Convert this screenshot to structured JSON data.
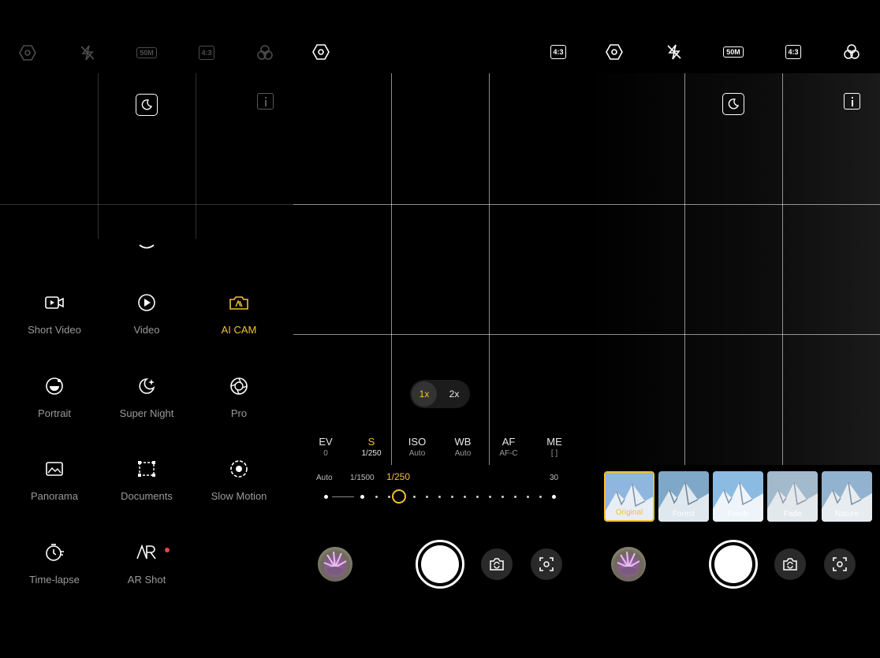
{
  "colors": {
    "accent": "#f2c230",
    "background": "#000000",
    "label": "#9a9a9a"
  },
  "mode_menu": {
    "modes": [
      {
        "label": "Short Video",
        "icon": "short-video-icon",
        "active": false
      },
      {
        "label": "Video",
        "icon": "video-icon",
        "active": false
      },
      {
        "label": "AI CAM",
        "icon": "ai-cam-icon",
        "active": true
      },
      {
        "label": "Portrait",
        "icon": "portrait-icon",
        "active": false
      },
      {
        "label": "Super Night",
        "icon": "super-night-icon",
        "active": false
      },
      {
        "label": "Pro",
        "icon": "pro-icon",
        "active": false
      },
      {
        "label": "Panorama",
        "icon": "panorama-icon",
        "active": false
      },
      {
        "label": "Documents",
        "icon": "documents-icon",
        "active": false
      },
      {
        "label": "Slow Motion",
        "icon": "slow-motion-icon",
        "active": false
      },
      {
        "label": "Time-lapse",
        "icon": "time-lapse-icon",
        "active": false
      },
      {
        "label": "AR Shot",
        "icon": "ar-shot-icon",
        "active": false,
        "badge": true
      }
    ]
  },
  "top_bar": {
    "icons": [
      "settings-hexagon-icon",
      "flash-off-icon",
      "resolution-50m-icon",
      "aspect-ratio-icon",
      "filters-icon"
    ],
    "resolution_label": "50M",
    "ratio_label": "4:3"
  },
  "pro": {
    "params": [
      {
        "key": "EV",
        "value": "0",
        "active": false
      },
      {
        "key": "S",
        "value": "1/250",
        "active": true
      },
      {
        "key": "ISO",
        "value": "Auto",
        "active": false
      },
      {
        "key": "WB",
        "value": "Auto",
        "active": false
      },
      {
        "key": "AF",
        "value": "AF-C",
        "active": false
      },
      {
        "key": "ME",
        "value": "[ ]",
        "active": false
      }
    ],
    "slider": {
      "min_label": "Auto",
      "left_label": "1/1500",
      "current_label": "1/250",
      "max_label": "30"
    },
    "zoom": {
      "options": [
        "1x",
        "2x"
      ],
      "selected": "1x"
    }
  },
  "filters": {
    "items": [
      {
        "label": "Original",
        "selected": true
      },
      {
        "label": "Forest",
        "selected": false
      },
      {
        "label": "Fresh",
        "selected": false
      },
      {
        "label": "Fade",
        "selected": false
      },
      {
        "label": "Nature",
        "selected": false
      }
    ]
  }
}
